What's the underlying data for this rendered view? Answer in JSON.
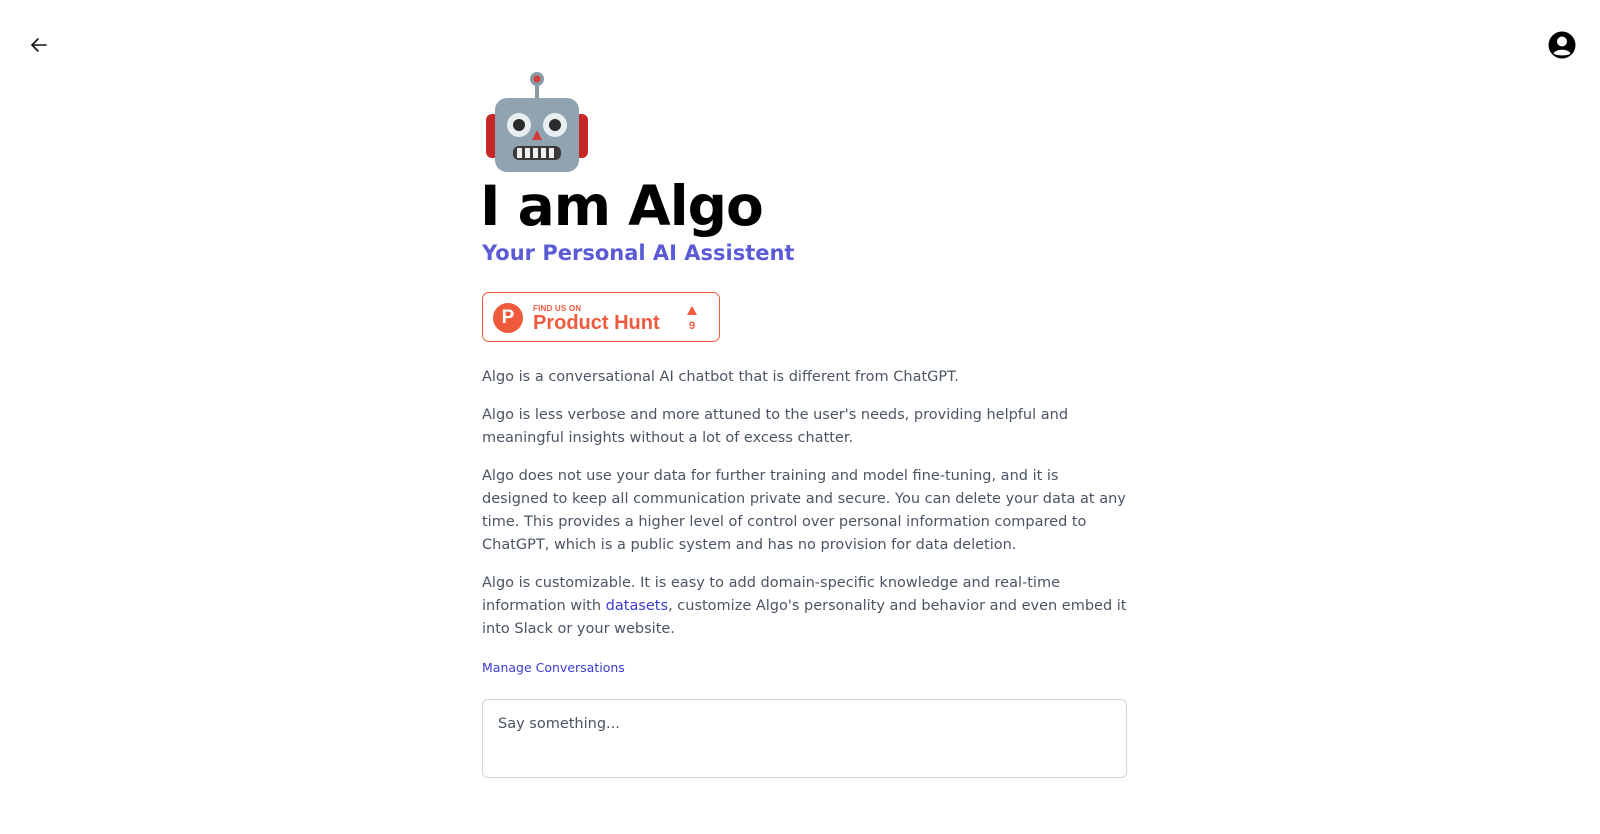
{
  "header": {
    "back_icon": "arrow-left-icon",
    "account_icon": "user-circle-icon"
  },
  "hero": {
    "emoji_icon": "robot-icon",
    "title": "I am Algo",
    "subtitle": "Your Personal AI Assistent"
  },
  "product_hunt": {
    "small_label": "FIND US ON",
    "big_label": "Product Hunt",
    "logo_letter": "P",
    "upvote_count": "9",
    "color": "#ef5a3c"
  },
  "content": {
    "p1": "Algo is a conversational AI chatbot that is different from ChatGPT.",
    "p2": "Algo is less verbose and more attuned to the user's needs, providing helpful and meaningful insights without a lot of excess chatter.",
    "p3": "Algo does not use your data for further training and model fine-tuning, and it is designed to keep all communication private and secure. You can delete your data at any time. This provides a higher level of control over personal information compared to ChatGPT, which is a public system and has no provision for data deletion.",
    "p4_before": "Algo is customizable. It is easy to add domain-specific knowledge and real-time information with ",
    "p4_link": "datasets",
    "p4_after": ", customize Algo's personality and behavior and even embed it into Slack or your website.",
    "manage_link": "Manage Conversations"
  },
  "chat": {
    "placeholder": "Say something...",
    "value": ""
  },
  "colors": {
    "accent": "#5b5bd6",
    "link": "#3b3bd1",
    "body_text": "#4b5563"
  }
}
